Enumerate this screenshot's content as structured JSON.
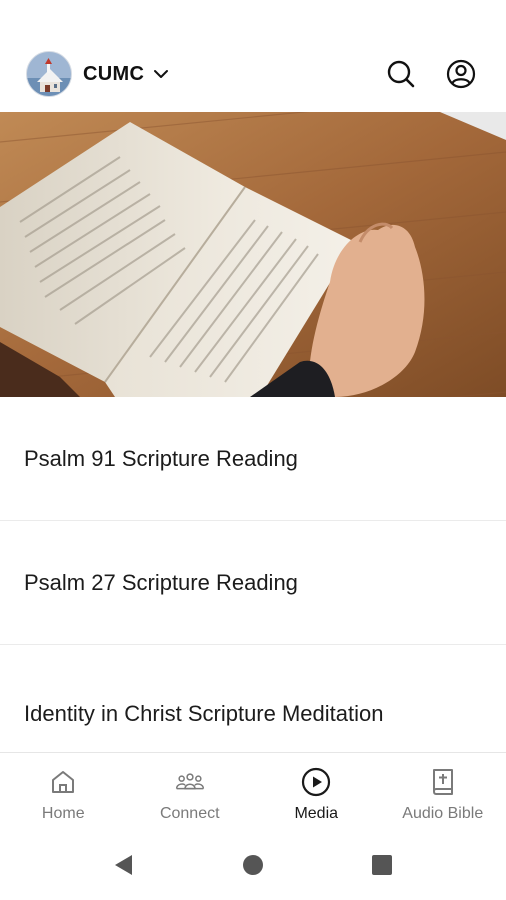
{
  "header": {
    "org_name": "CUMC"
  },
  "icons": {
    "dropdown": "chevron-down-icon",
    "search": "search-icon",
    "account": "account-circle-icon"
  },
  "hero": {
    "image": "open-bible-on-wooden-table"
  },
  "media_list": [
    {
      "title": "Psalm 91 Scripture Reading"
    },
    {
      "title": "Psalm 27 Scripture Reading"
    },
    {
      "title": "Identity in Christ Scripture Meditation"
    }
  ],
  "tabs": [
    {
      "label": "Home",
      "icon": "home-icon",
      "active": false
    },
    {
      "label": "Connect",
      "icon": "people-group-icon",
      "active": false
    },
    {
      "label": "Media",
      "icon": "play-circle-icon",
      "active": true
    },
    {
      "label": "Audio Bible",
      "icon": "bible-icon",
      "active": false
    }
  ],
  "system_nav": {
    "back": "back-triangle-icon",
    "home": "home-circle-icon",
    "recents": "recents-square-icon"
  },
  "colors": {
    "active_tab": "#1a1a1a",
    "inactive_tab": "#7a7a7a",
    "divider": "#ebebeb"
  }
}
